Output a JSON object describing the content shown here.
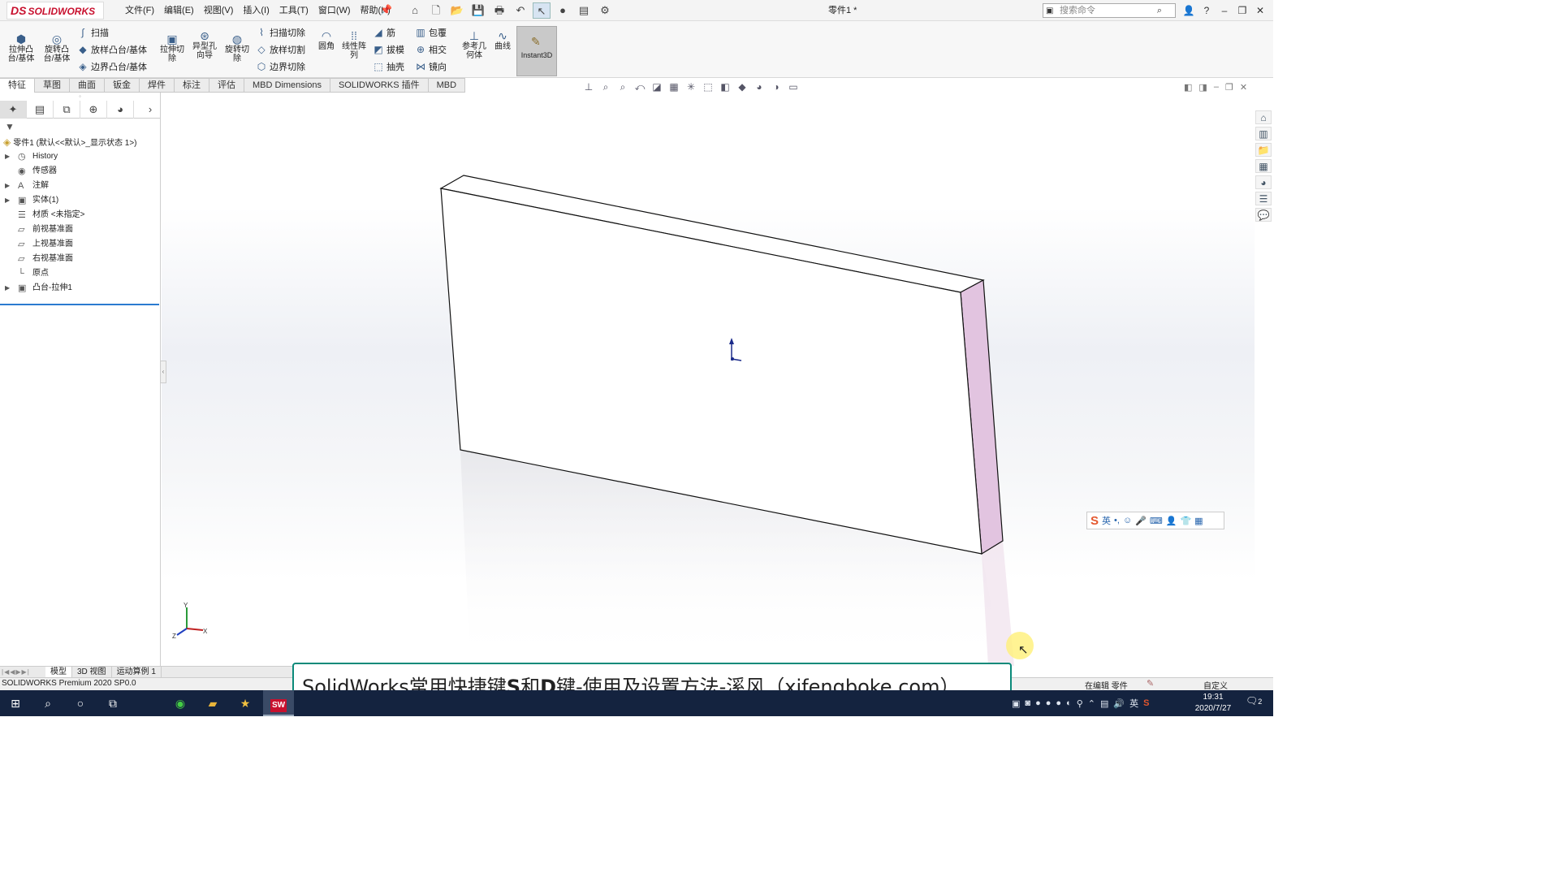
{
  "titlebar": {
    "logo": "SOLIDWORKS",
    "logo_mark": "DS",
    "menus": [
      "文件(F)",
      "编辑(E)",
      "视图(V)",
      "插入(I)",
      "工具(T)",
      "窗口(W)",
      "帮助(H)"
    ],
    "document_title": "零件1 *",
    "search_placeholder": "搜索命令"
  },
  "ribbon": {
    "extrude_boss": "拉伸凸台/基体",
    "revolve_boss": "旋转凸台/基体",
    "sweep": "扫描",
    "loft": "放样凸台/基体",
    "boundary_boss": "边界凸台/基体",
    "extrude_cut": "拉伸切除",
    "hole_wizard": "异型孔向导",
    "revolve_cut": "旋转切除",
    "swept_cut": "扫描切除",
    "lofted_cut": "放样切割",
    "boundary_cut": "边界切除",
    "fillet": "圆角",
    "linear_pattern": "线性阵列",
    "rib": "筋",
    "draft": "拔模",
    "shell": "抽壳",
    "wrap": "包覆",
    "intersect": "相交",
    "mirror": "镜向",
    "ref_geometry": "参考几何体",
    "curves": "曲线",
    "instant3d": "Instant3D"
  },
  "command_tabs": [
    "特征",
    "草图",
    "曲面",
    "钣金",
    "焊件",
    "标注",
    "评估",
    "MBD Dimensions",
    "SOLIDWORKS 插件",
    "MBD"
  ],
  "feature_tree": {
    "root": "零件1 (默认<<默认>_显示状态 1>)",
    "items": [
      {
        "label": "History",
        "expandable": true
      },
      {
        "label": "传感器",
        "expandable": false
      },
      {
        "label": "注解",
        "expandable": true
      },
      {
        "label": "实体(1)",
        "expandable": true
      },
      {
        "label": "材质 <未指定>",
        "expandable": false
      },
      {
        "label": "前视基准面",
        "expandable": false
      },
      {
        "label": "上视基准面",
        "expandable": false
      },
      {
        "label": "右视基准面",
        "expandable": false
      },
      {
        "label": "原点",
        "expandable": false
      },
      {
        "label": "凸台-拉伸1",
        "expandable": true
      }
    ]
  },
  "triad": {
    "x": "X",
    "y": "Y",
    "z": "Z"
  },
  "ime": {
    "mode": "英"
  },
  "bottom_tabs": [
    "模型",
    "3D 视图",
    "运动算例 1"
  ],
  "status": {
    "product": "SOLIDWORKS Premium 2020 SP0.0",
    "editing": "在编辑 零件",
    "units": "自定义"
  },
  "banner": {
    "part1": "SolidWorks",
    "part2": "常用快捷键",
    "part3": "S",
    "part4": "和",
    "part5": "D",
    "part6": "键-使用及设置方法-溪风（xifengboke.com）"
  },
  "taskbar": {
    "sw_icon_text": "SW",
    "ime_tray": "英",
    "time": "19:31",
    "date": "2020/7/27",
    "notifications": "2"
  },
  "colors": {
    "brand": "#c8102e",
    "selected_face": "#e2c4e0",
    "banner_border": "#0b8a7a",
    "taskbar": "#14233f"
  }
}
